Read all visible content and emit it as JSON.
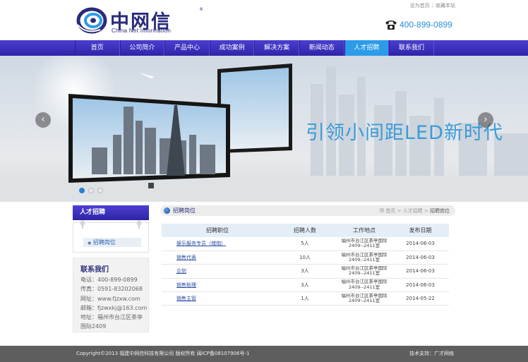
{
  "header": {
    "logo_cn": "中网信",
    "logo_en": "China Net Information",
    "logo_reg": "®",
    "top_links": [
      "设为首页",
      "收藏本站"
    ],
    "top_sep": "|",
    "phone": "400-899-0899"
  },
  "nav": {
    "items": [
      "首页",
      "公司简介",
      "产品中心",
      "成功案例",
      "解决方案",
      "新闻动态",
      "人才招聘",
      "联系我们"
    ],
    "active_index": 6
  },
  "banner": {
    "text": "引领小间距LED新时代",
    "prev": "‹",
    "next": "›",
    "slide_count": 3,
    "active_slide": 0
  },
  "sidebar": {
    "heading": "人才招聘",
    "link": "招聘岗位",
    "contact_title": "联系我们",
    "contact_lines": [
      "电话：400-899-0899",
      "传真：0591-83202068",
      "网址：www.fjzxw.com",
      "邮箱：fjzwxkj@163.com",
      "地址：福州市台江区茶亭",
      "国际2409"
    ]
  },
  "content": {
    "section_title": "招聘岗位",
    "crumbs": [
      "首页",
      ">",
      "人才招聘",
      ">"
    ],
    "crumb_current": "招聘岗位",
    "table_headers": [
      "招聘职位",
      "招聘人数",
      "工作地点",
      "发布日期"
    ],
    "rows": [
      {
        "position": "娱乐服务专员（储炮）",
        "count": "5人",
        "place_line1": "福州市台江区茶亭国际",
        "place_line2": "2409--2411室",
        "date": "2014-06-03"
      },
      {
        "position": "销售代表",
        "count": "10人",
        "place_line1": "福州市台江区茶亭国际",
        "place_line2": "2409--2411室",
        "date": "2014-06-03"
      },
      {
        "position": "企划",
        "count": "3人",
        "place_line1": "福州市台江区茶亭国际",
        "place_line2": "2409--2411室",
        "date": "2014-06-03"
      },
      {
        "position": "销售助理",
        "count": "3人",
        "place_line1": "福州市台江区茶亭国际",
        "place_line2": "2409--2411室",
        "date": "2014-06-03"
      },
      {
        "position": "销售主管",
        "count": "1人",
        "place_line1": "福州市台江区茶亭国际",
        "place_line2": "2409--2411室",
        "date": "2014-05-22"
      }
    ]
  },
  "footer": {
    "left": "Copyright©2013 福建中网信科技有限公司 版权所有 闽ICP备08107906号-1",
    "right": "技术支持：广才网络"
  },
  "colors": {
    "nav": "#3a30bd",
    "nav_active": "#2c9be8",
    "accent_blue": "#3b9ad8",
    "footer": "#5e5e5e"
  }
}
